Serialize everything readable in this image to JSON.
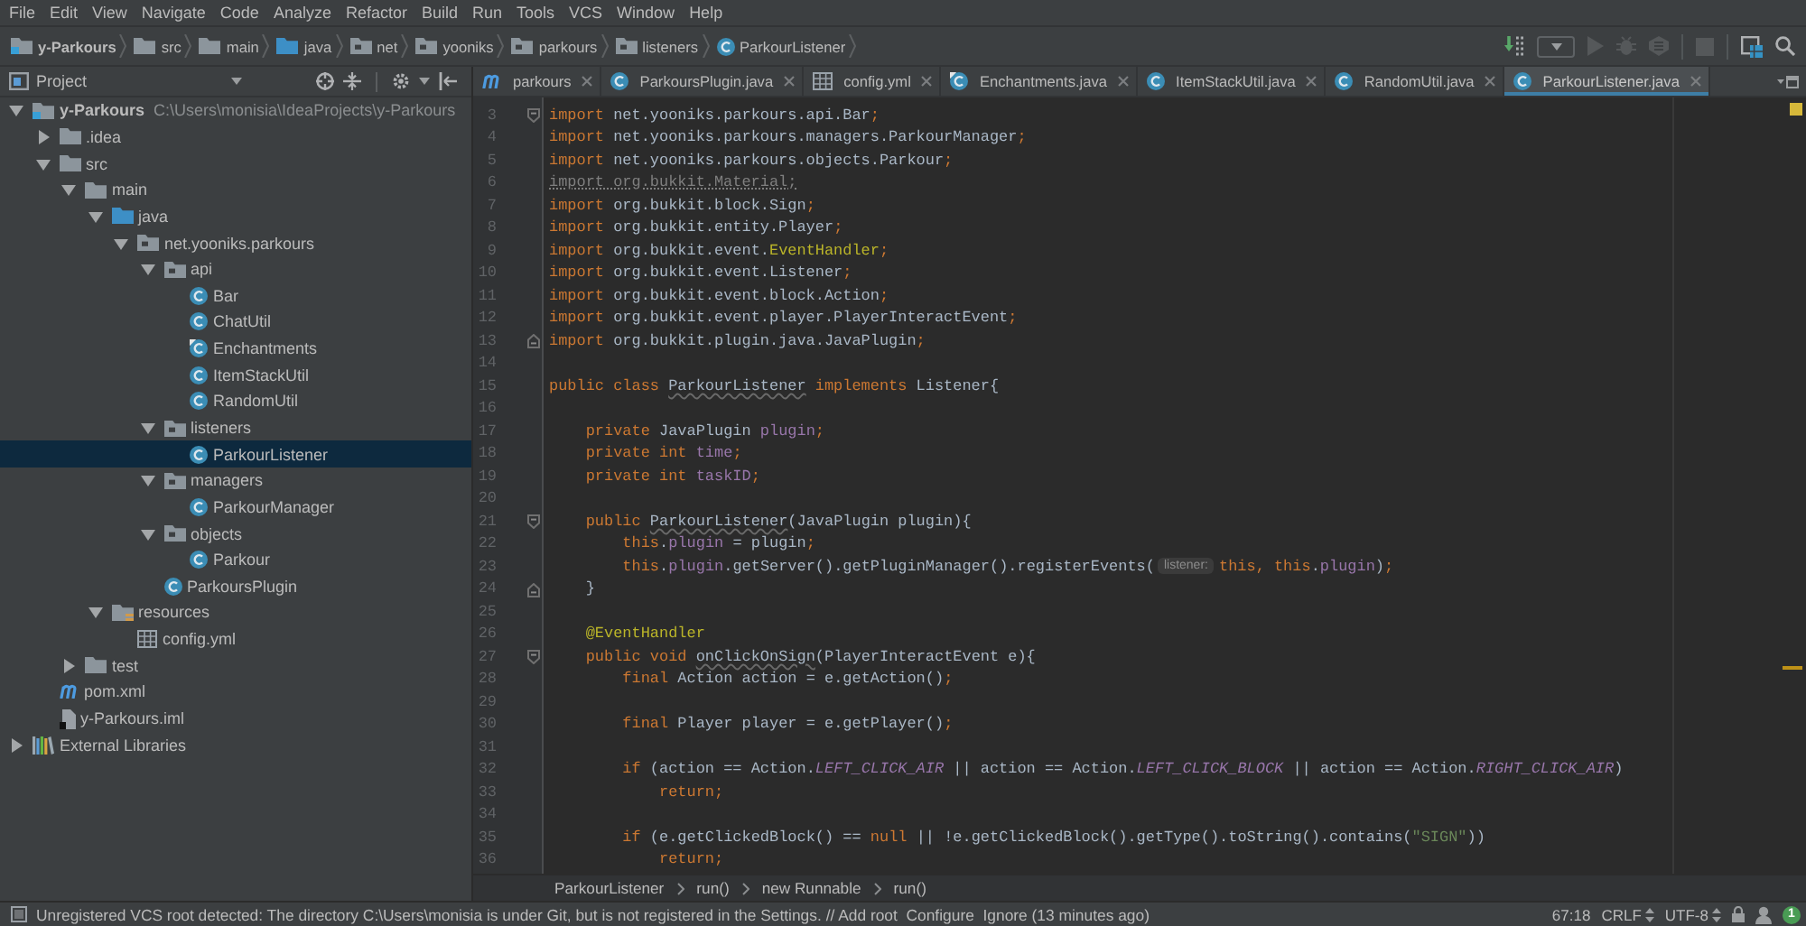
{
  "menu": [
    "File",
    "Edit",
    "View",
    "Navigate",
    "Code",
    "Analyze",
    "Refactor",
    "Build",
    "Run",
    "Tools",
    "VCS",
    "Window",
    "Help"
  ],
  "navbar": {
    "crumbs": [
      {
        "label": "y-Parkours",
        "kind": "module"
      },
      {
        "label": "src",
        "kind": "folder"
      },
      {
        "label": "main",
        "kind": "folder"
      },
      {
        "label": "java",
        "kind": "source"
      },
      {
        "label": "net",
        "kind": "package"
      },
      {
        "label": "yooniks",
        "kind": "package"
      },
      {
        "label": "parkours",
        "kind": "package"
      },
      {
        "label": "listeners",
        "kind": "package"
      },
      {
        "label": "ParkourListener",
        "kind": "class"
      }
    ],
    "toolbar": [
      {
        "kind": "build",
        "disabled": false
      },
      {
        "kind": "configuration",
        "disabled": false
      },
      {
        "kind": "run",
        "disabled": true
      },
      {
        "kind": "debug",
        "disabled": true
      },
      {
        "kind": "coverage",
        "disabled": true
      },
      {
        "kind": "stop",
        "disabled": true
      },
      {
        "kind": "structure",
        "disabled": false
      },
      {
        "kind": "search",
        "disabled": false
      }
    ]
  },
  "project_panel": {
    "title": "Project",
    "tree": [
      {
        "label": "y-Parkours",
        "kind": "module",
        "path": "C:\\Users\\monisia\\IdeaProjects\\y-Parkours",
        "expanded": true,
        "selected": false,
        "children": [
          {
            "label": ".idea",
            "kind": "folder",
            "expanded": false,
            "selected": false
          },
          {
            "label": "src",
            "kind": "folder",
            "expanded": true,
            "selected": false,
            "children": [
              {
                "label": "main",
                "kind": "folder",
                "expanded": true,
                "selected": false,
                "children": [
                  {
                    "label": "java",
                    "kind": "source",
                    "expanded": true,
                    "selected": false,
                    "children": [
                      {
                        "label": "net.yooniks.parkours",
                        "kind": "package",
                        "expanded": true,
                        "selected": false,
                        "children": [
                          {
                            "label": "api",
                            "kind": "package",
                            "expanded": true,
                            "selected": false,
                            "children": [
                              {
                                "label": "Bar",
                                "kind": "class",
                                "selected": false
                              },
                              {
                                "label": "ChatUtil",
                                "kind": "class",
                                "selected": false
                              },
                              {
                                "label": "Enchantments",
                                "kind": "class-marked",
                                "selected": false
                              },
                              {
                                "label": "ItemStackUtil",
                                "kind": "class",
                                "selected": false
                              },
                              {
                                "label": "RandomUtil",
                                "kind": "class",
                                "selected": false
                              }
                            ]
                          },
                          {
                            "label": "listeners",
                            "kind": "package",
                            "expanded": true,
                            "selected": false,
                            "children": [
                              {
                                "label": "ParkourListener",
                                "kind": "class",
                                "selected": true
                              }
                            ]
                          },
                          {
                            "label": "managers",
                            "kind": "package",
                            "expanded": true,
                            "selected": false,
                            "children": [
                              {
                                "label": "ParkourManager",
                                "kind": "class",
                                "selected": false
                              }
                            ]
                          },
                          {
                            "label": "objects",
                            "kind": "package",
                            "expanded": true,
                            "selected": false,
                            "children": [
                              {
                                "label": "Parkour",
                                "kind": "class",
                                "selected": false
                              }
                            ]
                          },
                          {
                            "label": "ParkoursPlugin",
                            "kind": "class",
                            "selected": false
                          }
                        ]
                      }
                    ]
                  },
                  {
                    "label": "resources",
                    "kind": "resources",
                    "expanded": true,
                    "selected": false,
                    "children": [
                      {
                        "label": "config.yml",
                        "kind": "yml",
                        "selected": false
                      }
                    ]
                  }
                ]
              },
              {
                "label": "test",
                "kind": "folder",
                "expanded": false,
                "selected": false
              }
            ]
          },
          {
            "label": "pom.xml",
            "kind": "maven",
            "selected": false
          },
          {
            "label": "y-Parkours.iml",
            "kind": "iml",
            "selected": false
          }
        ]
      },
      {
        "label": "External Libraries",
        "kind": "libraries",
        "expanded": false,
        "selected": false
      }
    ]
  },
  "editor": {
    "tabs": [
      {
        "label": "parkours",
        "kind": "maven",
        "selected": false
      },
      {
        "label": "ParkoursPlugin.java",
        "kind": "class",
        "selected": false
      },
      {
        "label": "config.yml",
        "kind": "yml",
        "selected": false
      },
      {
        "label": "Enchantments.java",
        "kind": "class-marked",
        "selected": false
      },
      {
        "label": "ItemStackUtil.java",
        "kind": "class",
        "selected": false
      },
      {
        "label": "RandomUtil.java",
        "kind": "class",
        "selected": false
      },
      {
        "label": "ParkourListener.java",
        "kind": "class",
        "selected": true
      }
    ],
    "lines": [
      {
        "number": "3",
        "kind": "fold-start",
        "tokens": [
          {
            "kind": "keyword",
            "text": "import"
          },
          {
            "kind": "plain",
            "text": " net.yooniks.parkours.api.Bar"
          },
          {
            "kind": "keyword",
            "text": ";"
          }
        ]
      },
      {
        "number": "4",
        "kind": "code",
        "tokens": [
          {
            "kind": "keyword",
            "text": "import"
          },
          {
            "kind": "plain",
            "text": " net.yooniks.parkours.managers.ParkourManager"
          },
          {
            "kind": "keyword",
            "text": ";"
          }
        ]
      },
      {
        "number": "5",
        "kind": "code",
        "tokens": [
          {
            "kind": "keyword",
            "text": "import"
          },
          {
            "kind": "plain",
            "text": " net.yooniks.parkours.objects.Parkour"
          },
          {
            "kind": "keyword",
            "text": ";"
          }
        ]
      },
      {
        "number": "6",
        "kind": "code",
        "tokens": [
          {
            "kind": "unused",
            "text": "import org.bukkit.Material;"
          }
        ]
      },
      {
        "number": "7",
        "kind": "code",
        "tokens": [
          {
            "kind": "keyword",
            "text": "import"
          },
          {
            "kind": "plain",
            "text": " org.bukkit.block.Sign"
          },
          {
            "kind": "keyword",
            "text": ";"
          }
        ]
      },
      {
        "number": "8",
        "kind": "code",
        "tokens": [
          {
            "kind": "keyword",
            "text": "import"
          },
          {
            "kind": "plain",
            "text": " org.bukkit.entity.Player"
          },
          {
            "kind": "keyword",
            "text": ";"
          }
        ]
      },
      {
        "number": "9",
        "kind": "code",
        "tokens": [
          {
            "kind": "keyword",
            "text": "import"
          },
          {
            "kind": "plain",
            "text": " org.bukkit.event."
          },
          {
            "kind": "annotation",
            "text": "EventHandler"
          },
          {
            "kind": "keyword",
            "text": ";"
          }
        ]
      },
      {
        "number": "10",
        "kind": "code",
        "tokens": [
          {
            "kind": "keyword",
            "text": "import"
          },
          {
            "kind": "plain",
            "text": " org.bukkit.event.Listener"
          },
          {
            "kind": "keyword",
            "text": ";"
          }
        ]
      },
      {
        "number": "11",
        "kind": "code",
        "tokens": [
          {
            "kind": "keyword",
            "text": "import"
          },
          {
            "kind": "plain",
            "text": " org.bukkit.event.block.Action"
          },
          {
            "kind": "keyword",
            "text": ";"
          }
        ]
      },
      {
        "number": "12",
        "kind": "code",
        "tokens": [
          {
            "kind": "keyword",
            "text": "import"
          },
          {
            "kind": "plain",
            "text": " org.bukkit.event.player.PlayerInteractEvent"
          },
          {
            "kind": "keyword",
            "text": ";"
          }
        ]
      },
      {
        "number": "13",
        "kind": "fold-end",
        "tokens": [
          {
            "kind": "keyword",
            "text": "import"
          },
          {
            "kind": "plain",
            "text": " org.bukkit.plugin.java.JavaPlugin"
          },
          {
            "kind": "keyword",
            "text": ";"
          }
        ]
      },
      {
        "number": "14",
        "kind": "code"
      },
      {
        "number": "15",
        "kind": "code",
        "tokens": [
          {
            "kind": "keyword",
            "text": "public class "
          },
          {
            "kind": "warn",
            "text": "ParkourListener"
          },
          {
            "kind": "keyword",
            "text": " implements"
          },
          {
            "kind": "plain",
            "text": " Listener{"
          }
        ]
      },
      {
        "number": "16",
        "kind": "code"
      },
      {
        "number": "17",
        "kind": "code",
        "tokens": [
          {
            "kind": "keyword",
            "text": "    private "
          },
          {
            "kind": "plain",
            "text": "JavaPlugin "
          },
          {
            "kind": "field",
            "text": "plugin"
          },
          {
            "kind": "keyword",
            "text": ";"
          }
        ]
      },
      {
        "number": "18",
        "kind": "code",
        "tokens": [
          {
            "kind": "keyword",
            "text": "    private int "
          },
          {
            "kind": "field",
            "text": "time"
          },
          {
            "kind": "keyword",
            "text": ";"
          }
        ]
      },
      {
        "number": "19",
        "kind": "code",
        "tokens": [
          {
            "kind": "keyword",
            "text": "    private int "
          },
          {
            "kind": "field",
            "text": "taskID"
          },
          {
            "kind": "keyword",
            "text": ";"
          }
        ]
      },
      {
        "number": "20",
        "kind": "code"
      },
      {
        "number": "21",
        "kind": "fold-start",
        "tokens": [
          {
            "kind": "keyword",
            "text": "    public "
          },
          {
            "kind": "warn",
            "text": "ParkourListener"
          },
          {
            "kind": "plain",
            "text": "(JavaPlugin plugin){"
          }
        ]
      },
      {
        "number": "22",
        "kind": "code",
        "tokens": [
          {
            "kind": "keyword",
            "text": "        this"
          },
          {
            "kind": "plain",
            "text": "."
          },
          {
            "kind": "field",
            "text": "plugin"
          },
          {
            "kind": "plain",
            "text": " = plugin"
          },
          {
            "kind": "keyword",
            "text": ";"
          }
        ]
      },
      {
        "number": "23",
        "kind": "code",
        "tokens": [
          {
            "kind": "keyword",
            "text": "        this"
          },
          {
            "kind": "plain",
            "text": "."
          },
          {
            "kind": "field",
            "text": "plugin"
          },
          {
            "kind": "plain",
            "text": ".getServer().getPluginManager().registerEvents("
          },
          {
            "kind": "hint",
            "text": "listener:"
          },
          {
            "kind": "keyword",
            "text": "this, this"
          },
          {
            "kind": "plain",
            "text": "."
          },
          {
            "kind": "field",
            "text": "plugin"
          },
          {
            "kind": "plain",
            "text": ")"
          },
          {
            "kind": "keyword",
            "text": ";"
          }
        ]
      },
      {
        "number": "24",
        "kind": "fold-end",
        "tokens": [
          {
            "kind": "plain",
            "text": "    }"
          }
        ]
      },
      {
        "number": "25",
        "kind": "code"
      },
      {
        "number": "26",
        "kind": "code",
        "tokens": [
          {
            "kind": "annotation",
            "text": "    @EventHandler"
          }
        ]
      },
      {
        "number": "27",
        "kind": "fold-start",
        "tokens": [
          {
            "kind": "keyword",
            "text": "    public void "
          },
          {
            "kind": "warn",
            "text": "onClickOnSign"
          },
          {
            "kind": "plain",
            "text": "(PlayerInteractEvent e){"
          }
        ]
      },
      {
        "number": "28",
        "kind": "code",
        "tokens": [
          {
            "kind": "keyword",
            "text": "        final "
          },
          {
            "kind": "plain",
            "text": "Action action = e.getAction()"
          },
          {
            "kind": "keyword",
            "text": ";"
          }
        ]
      },
      {
        "number": "29",
        "kind": "code"
      },
      {
        "number": "30",
        "kind": "code",
        "tokens": [
          {
            "kind": "keyword",
            "text": "        final "
          },
          {
            "kind": "plain",
            "text": "Player player = e.getPlayer()"
          },
          {
            "kind": "keyword",
            "text": ";"
          }
        ]
      },
      {
        "number": "31",
        "kind": "code"
      },
      {
        "number": "32",
        "kind": "code",
        "tokens": [
          {
            "kind": "keyword",
            "text": "        if "
          },
          {
            "kind": "plain",
            "text": "(action == Action."
          },
          {
            "kind": "constant",
            "text": "LEFT_CLICK_AIR"
          },
          {
            "kind": "plain",
            "text": " || action == Action."
          },
          {
            "kind": "constant",
            "text": "LEFT_CLICK_BLOCK"
          },
          {
            "kind": "plain",
            "text": " || action == Action."
          },
          {
            "kind": "constant",
            "text": "RIGHT_CLICK_AIR"
          },
          {
            "kind": "plain",
            "text": ")"
          }
        ]
      },
      {
        "number": "33",
        "kind": "code",
        "tokens": [
          {
            "kind": "keyword",
            "text": "            return;"
          }
        ]
      },
      {
        "number": "34",
        "kind": "code"
      },
      {
        "number": "35",
        "kind": "code",
        "tokens": [
          {
            "kind": "keyword",
            "text": "        if "
          },
          {
            "kind": "plain",
            "text": "(e.getClickedBlock() == "
          },
          {
            "kind": "keyword",
            "text": "null"
          },
          {
            "kind": "plain",
            "text": " || !e.getClickedBlock().getType().toString().contains("
          },
          {
            "kind": "string",
            "text": "\"SIGN\""
          },
          {
            "kind": "plain",
            "text": "))"
          }
        ]
      },
      {
        "number": "36",
        "kind": "code",
        "tokens": [
          {
            "kind": "keyword",
            "text": "            return;"
          }
        ]
      }
    ],
    "breadcrumbs": [
      "ParkourListener",
      "run()",
      "new Runnable",
      "run()"
    ]
  },
  "status_bar": {
    "message": "Unregistered VCS root detected: The directory C:\\Users\\monisia is under Git, but is not registered in the Settings. // Add root  Configure  Ignore (13 minutes ago)",
    "position": "67:18",
    "line_separator": "CRLF",
    "encoding": "UTF-8",
    "notifications": "1"
  }
}
